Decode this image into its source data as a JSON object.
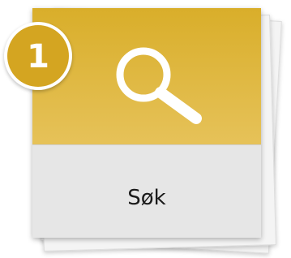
{
  "tile": {
    "label": "Søk",
    "icon": "search-icon",
    "accent_color": "#e0b944",
    "badge": {
      "number": "1",
      "color": "#d4a521"
    }
  }
}
